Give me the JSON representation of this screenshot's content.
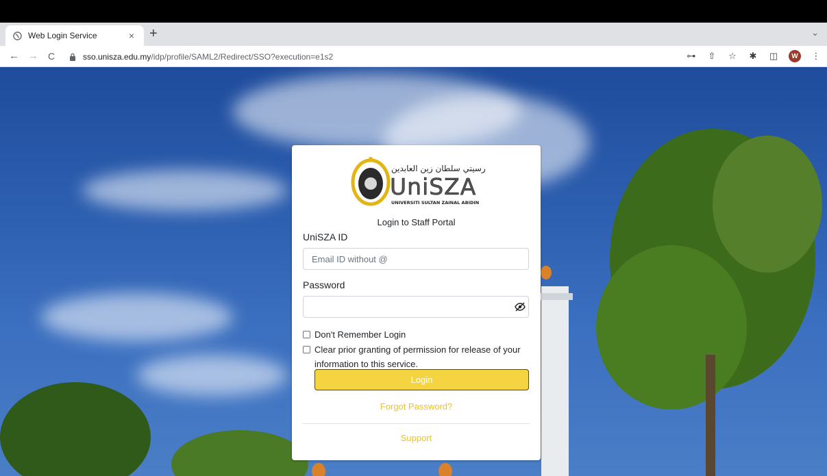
{
  "browser": {
    "tab_title": "Web Login Service",
    "tab_close": "×",
    "new_tab": "+",
    "tab_list": "⌄",
    "url_host": "sso.unisza.edu.my",
    "url_path": "/idp/profile/SAML2/Redirect/SSO?execution=e1s2",
    "avatar_letter": "W",
    "icons": {
      "back": "←",
      "forward": "→",
      "reload": "C",
      "key": "⊶",
      "share": "⇧",
      "star": "☆",
      "extensions": "✱",
      "sidepanel": "◫",
      "menu": "⋮"
    }
  },
  "login": {
    "logo_name": "UniSZA",
    "logo_arabic": "اونيۏرسيتي سلطان زين العابدين",
    "logo_subtitle": "UNIVERSITI SULTAN ZAINAL ABIDIN",
    "title": "Login to Staff Portal",
    "id_label": "UniSZA ID",
    "id_placeholder": "Email ID without @",
    "password_label": "Password",
    "password_value": "",
    "remember_label": "Don't Remember Login",
    "clear_label": "Clear prior granting of permission for release of your information to this service.",
    "login_button": "Login",
    "forgot_link": "Forgot Password?",
    "support_link": "Support"
  },
  "colors": {
    "accent": "#f0c419",
    "button_bg": "#f5d442",
    "sky": "#2d5fb0"
  }
}
